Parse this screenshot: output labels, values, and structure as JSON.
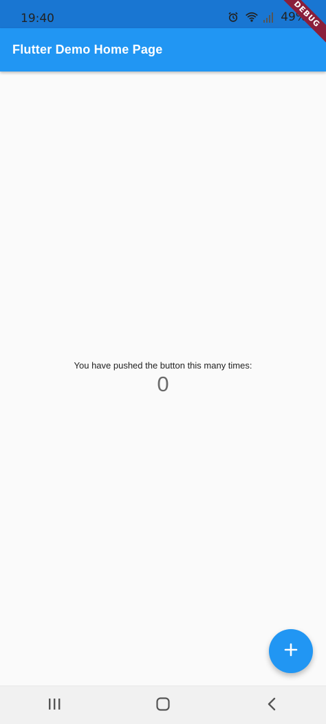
{
  "status_bar": {
    "time": "19:40",
    "battery": "49%",
    "icons": [
      "alarm-icon",
      "wifi-icon",
      "signal-icon"
    ]
  },
  "app_bar": {
    "title": "Flutter Demo Home Page"
  },
  "debug_banner": {
    "label": "DEBUG"
  },
  "content": {
    "message": "You have pushed the button this many times:",
    "counter": "0"
  },
  "fab": {
    "icon": "plus-icon"
  },
  "nav_bar": {
    "buttons": [
      "recent-apps-icon",
      "home-icon",
      "back-icon"
    ]
  },
  "colors": {
    "primary": "#2196f3",
    "status_bar": "#1976d2",
    "debug": "#8a1f3b"
  }
}
